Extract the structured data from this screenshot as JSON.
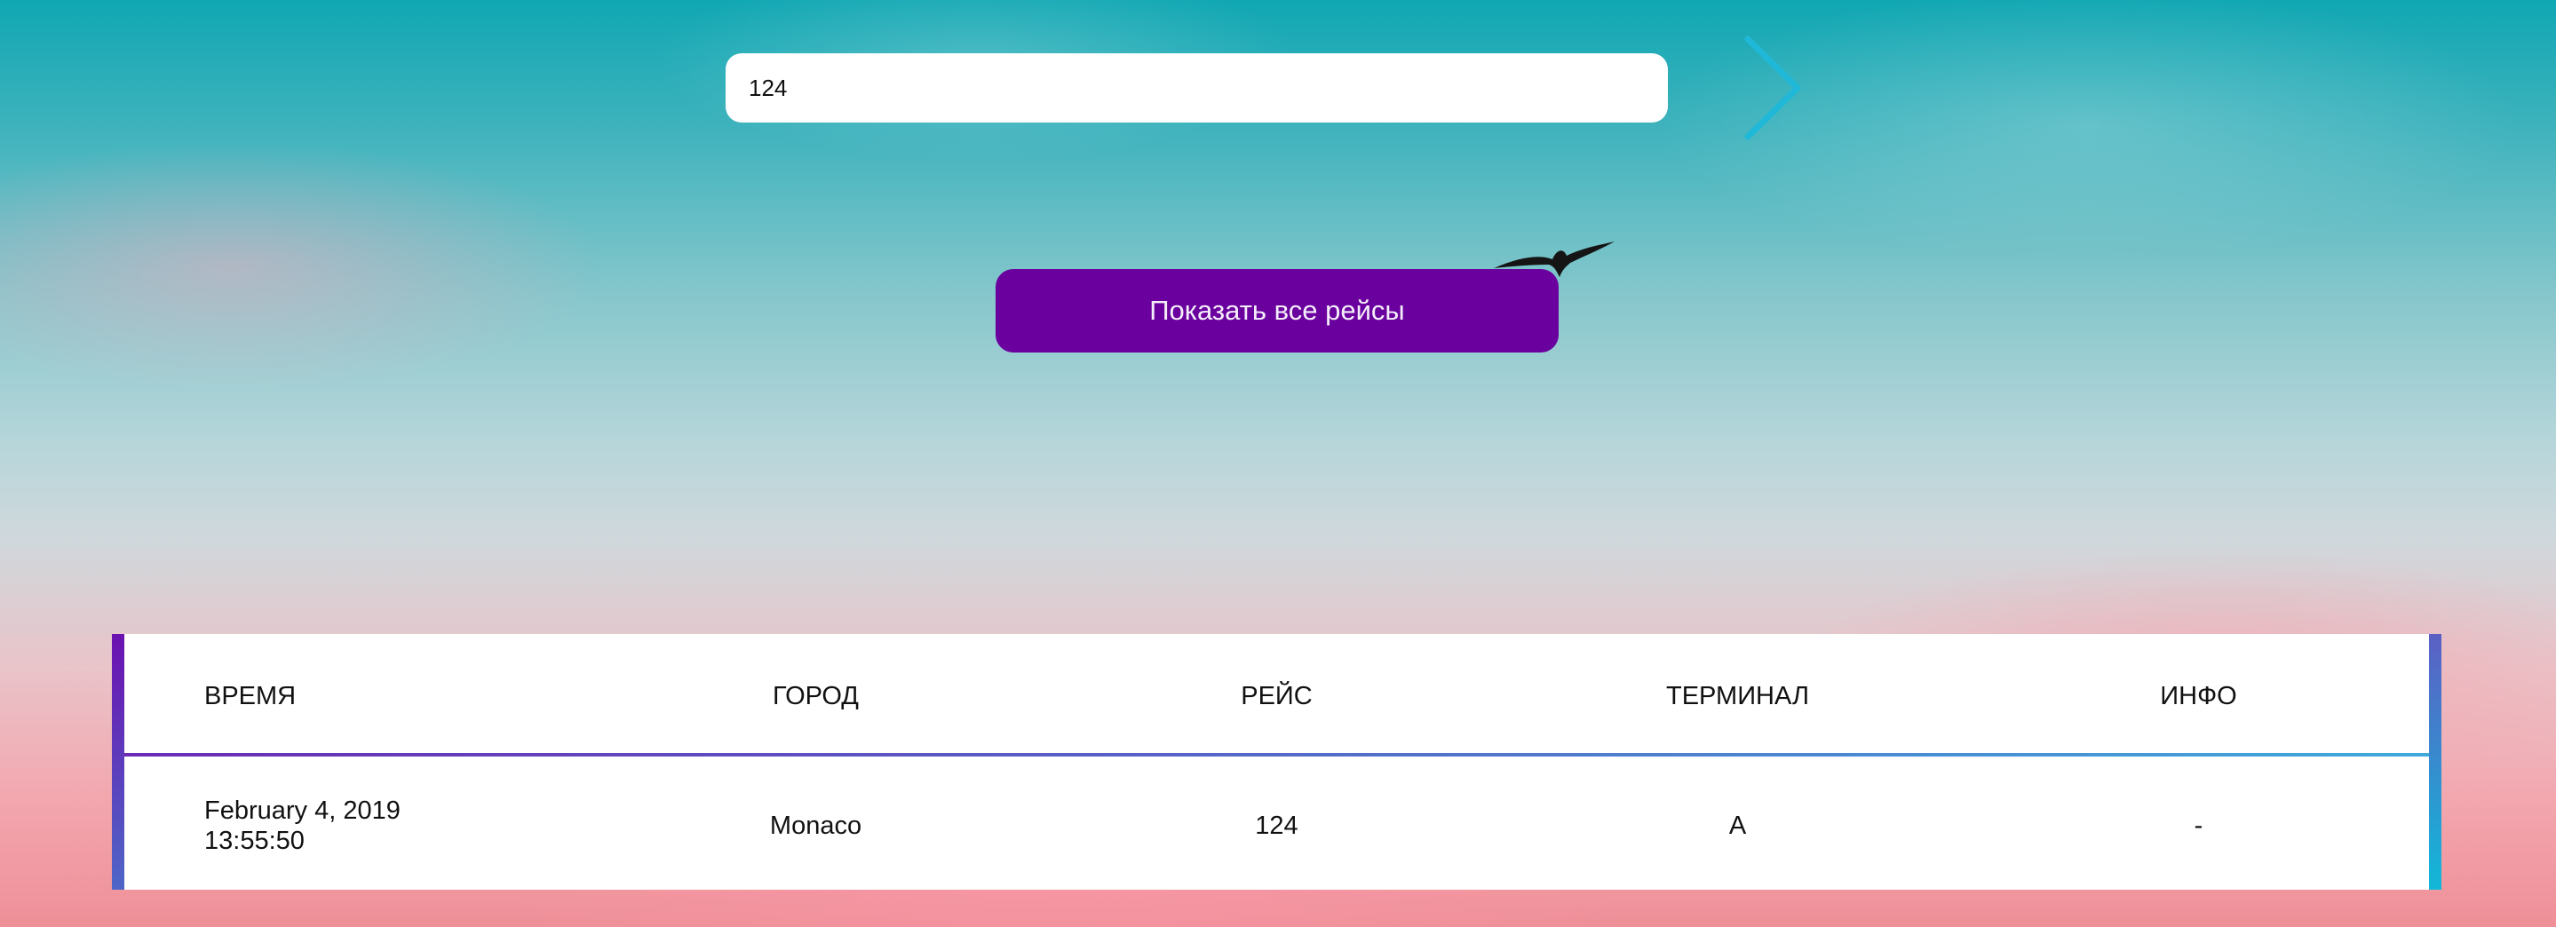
{
  "search": {
    "value": "124"
  },
  "navigation": {
    "next_icon": "chevron-right-icon",
    "next_color": "#20b8d8"
  },
  "actions": {
    "show_all_label": "Показать все рейсы",
    "show_all_color": "#6a009e"
  },
  "table": {
    "columns": [
      "ВРЕМЯ",
      "ГОРОД",
      "РЕЙС",
      "ТЕРМИНАЛ",
      "ИНФО"
    ],
    "rows": [
      {
        "date": "February 4, 2019",
        "time": "13:55:50",
        "city": "Monaco",
        "flight": "124",
        "terminal": "A",
        "info": "-"
      }
    ]
  },
  "theme": {
    "accent_purple": "#6b12b0",
    "accent_cyan": "#12b8d8"
  }
}
